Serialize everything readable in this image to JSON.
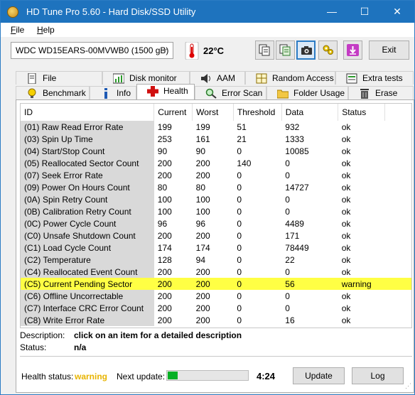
{
  "window": {
    "title": "HD Tune Pro 5.60 - Hard Disk/SSD Utility"
  },
  "menu": [
    {
      "key": "F",
      "rest": "ile"
    },
    {
      "key": "H",
      "rest": "elp"
    }
  ],
  "toolbar": {
    "drive": "WDC WD15EARS-00MVWB0 (1500 gB)",
    "temperature": "22°C",
    "exit_label": "Exit"
  },
  "tabs_top": [
    "File Benchmark",
    "Disk monitor",
    "AAM",
    "Random Access",
    "Extra tests"
  ],
  "tabs_bottom": [
    "Benchmark",
    "Info",
    "Health",
    "Error Scan",
    "Folder Usage",
    "Erase"
  ],
  "active_tab": "Health",
  "table": {
    "headers": [
      "ID",
      "Current",
      "Worst",
      "Threshold",
      "Data",
      "Status"
    ],
    "rows": [
      [
        "(01) Raw Read Error Rate",
        "199",
        "199",
        "51",
        "932",
        "ok"
      ],
      [
        "(03) Spin Up Time",
        "253",
        "161",
        "21",
        "1333",
        "ok"
      ],
      [
        "(04) Start/Stop Count",
        "90",
        "90",
        "0",
        "10085",
        "ok"
      ],
      [
        "(05) Reallocated Sector Count",
        "200",
        "200",
        "140",
        "0",
        "ok"
      ],
      [
        "(07) Seek Error Rate",
        "200",
        "200",
        "0",
        "0",
        "ok"
      ],
      [
        "(09) Power On Hours Count",
        "80",
        "80",
        "0",
        "14727",
        "ok"
      ],
      [
        "(0A) Spin Retry Count",
        "100",
        "100",
        "0",
        "0",
        "ok"
      ],
      [
        "(0B) Calibration Retry Count",
        "100",
        "100",
        "0",
        "0",
        "ok"
      ],
      [
        "(0C) Power Cycle Count",
        "96",
        "96",
        "0",
        "4489",
        "ok"
      ],
      [
        "(C0) Unsafe Shutdown Count",
        "200",
        "200",
        "0",
        "171",
        "ok"
      ],
      [
        "(C1) Load Cycle Count",
        "174",
        "174",
        "0",
        "78449",
        "ok"
      ],
      [
        "(C2) Temperature",
        "128",
        "94",
        "0",
        "22",
        "ok"
      ],
      [
        "(C4) Reallocated Event Count",
        "200",
        "200",
        "0",
        "0",
        "ok"
      ],
      [
        "(C5) Current Pending Sector",
        "200",
        "200",
        "0",
        "56",
        "warning"
      ],
      [
        "(C6) Offline Uncorrectable",
        "200",
        "200",
        "0",
        "0",
        "ok"
      ],
      [
        "(C7) Interface CRC Error Count",
        "200",
        "200",
        "0",
        "0",
        "ok"
      ],
      [
        "(C8) Write Error Rate",
        "200",
        "200",
        "0",
        "16",
        "ok"
      ]
    ]
  },
  "description": {
    "label": "Description:",
    "value": "click on an item for a detailed description"
  },
  "status": {
    "label": "Status:",
    "value": "n/a"
  },
  "footer": {
    "health_label": "Health status:",
    "health_value": "warning",
    "next_update_label": "Next update:",
    "next_update_progress_fraction": 0.12,
    "time": "4:24",
    "update_label": "Update",
    "log_label": "Log"
  },
  "colors": {
    "warning_row": "#ffff44",
    "health_warning": "#e8b400",
    "titlebar": "#1e73be"
  }
}
